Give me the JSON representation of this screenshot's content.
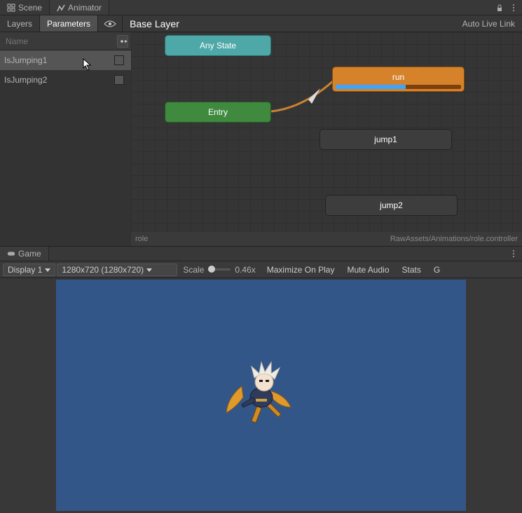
{
  "tabs": {
    "scene": "Scene",
    "animator": "Animator"
  },
  "toolbar": {
    "layers": "Layers",
    "parameters": "Parameters",
    "breadcrumb": "Base Layer",
    "livelink": "Auto Live Link"
  },
  "search": {
    "placeholder": "Name"
  },
  "params": [
    {
      "name": "IsJumping1",
      "checked": false
    },
    {
      "name": "IsJumping2",
      "checked": false
    }
  ],
  "nodes": {
    "anystate": "Any State",
    "entry": "Entry",
    "run": "run",
    "jump1": "jump1",
    "jump2": "jump2"
  },
  "footer": {
    "left": "role",
    "right": "RawAssets/Animations/role.controller"
  },
  "gameTabs": {
    "game": "Game"
  },
  "gameToolbar": {
    "display": "Display 1",
    "resolution": "1280x720 (1280x720)",
    "scaleLabel": "Scale",
    "scaleValue": "0.46x",
    "maximize": "Maximize On Play",
    "mute": "Mute Audio",
    "stats": "Stats",
    "gizmos": "G"
  },
  "colors": {
    "orange": "#d5822a",
    "teal": "#4fa8a8",
    "green": "#3f8a3f",
    "viewport": "#335688"
  }
}
